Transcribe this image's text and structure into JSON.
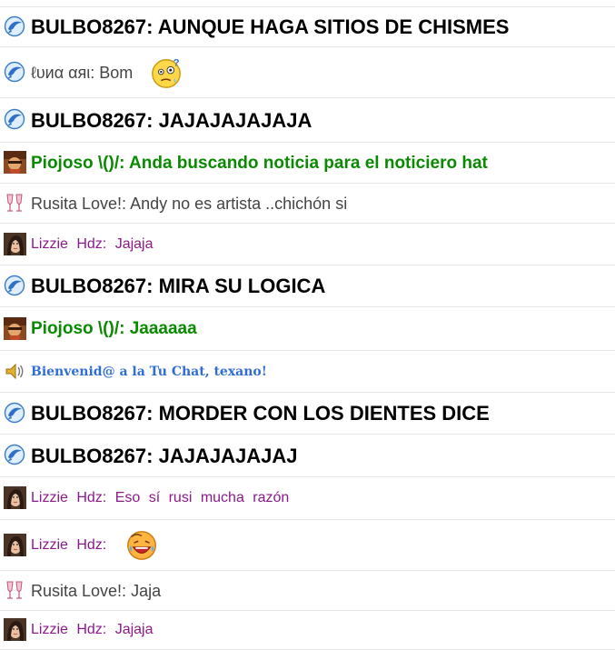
{
  "messages": [
    {
      "kind": "bulbo",
      "text": "BULBO8267: AUNQUE HAGA SITIOS DE CHISMES",
      "icon": "dolphin-icon"
    },
    {
      "kind": "luna",
      "name": "ℓυиα αяι:",
      "text": "Bom",
      "icon": "dolphin-icon",
      "emoji": "thinking-face-emoji"
    },
    {
      "kind": "bulbo",
      "text": "BULBO8267: JAJAJAJAJAJA",
      "icon": "dolphin-icon"
    },
    {
      "kind": "pio",
      "text": "Piojoso \\()/: Anda buscando noticia para  el noticiero  hat",
      "icon": "pirate-avatar-icon"
    },
    {
      "kind": "rus",
      "name": "Rusita Love!:",
      "text": "Andy no es artista ..chichón si",
      "icon": "champagne-glasses-icon"
    },
    {
      "kind": "liz",
      "text": "Lizzie Hdz: Jajaja",
      "icon": "woman-avatar-icon"
    },
    {
      "kind": "bulbo",
      "text": "BULBO8267: MIRA SU LOGICA",
      "icon": "dolphin-icon"
    },
    {
      "kind": "pio",
      "text": "Piojoso \\()/: Jaaaaaa",
      "icon": "pirate-avatar-icon"
    },
    {
      "kind": "sys",
      "text": "Bienvenid@ a la Tu Chat, texano!",
      "icon": "speaker-icon"
    },
    {
      "kind": "bulbo",
      "text": "BULBO8267: MORDER CON LOS DIENTES DICE",
      "icon": "dolphin-icon"
    },
    {
      "kind": "bulbo",
      "text": "BULBO8267: JAJAJAJAJAJ",
      "icon": "dolphin-icon"
    },
    {
      "kind": "liz",
      "text": "Lizzie Hdz: Eso sí rusi mucha razón",
      "icon": "woman-avatar-icon"
    },
    {
      "kind": "liz",
      "text": "Lizzie Hdz:",
      "icon": "woman-avatar-icon",
      "emoji": "laughing-crying-emoji"
    },
    {
      "kind": "rus",
      "name": "Rusita Love!:",
      "text": "Jaja",
      "icon": "champagne-glasses-icon"
    },
    {
      "kind": "liz",
      "text": "Lizzie Hdz: Jajaja",
      "icon": "woman-avatar-icon"
    }
  ]
}
